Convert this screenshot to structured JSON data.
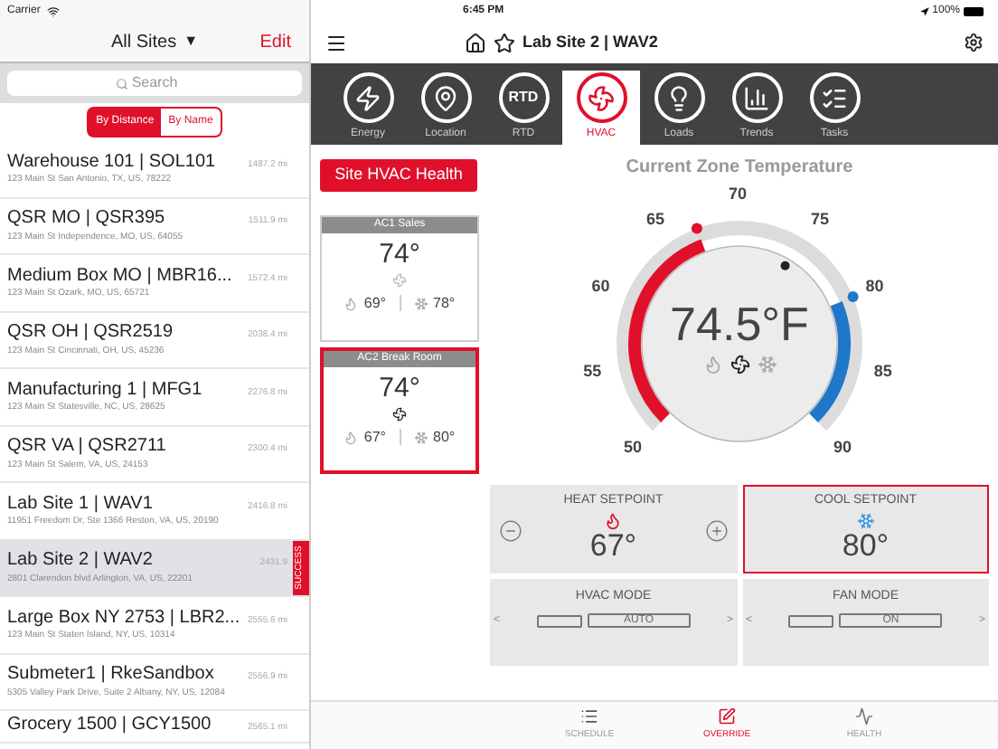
{
  "status_bar": {
    "carrier": "Carrier",
    "time": "6:45 PM",
    "battery": "100%"
  },
  "sidebar": {
    "title": "All Sites",
    "title_caret": "▼",
    "edit": "Edit",
    "search": {
      "placeholder": "Search"
    },
    "sort": [
      {
        "label": "By Distance",
        "selected": true
      },
      {
        "label": "By Name",
        "selected": false
      }
    ],
    "sites": [
      {
        "name": "Warehouse 101 | SOL101",
        "address": "123 Main St San Antonio, TX, US, 78222",
        "distance": "1487.2 mi",
        "selected": false
      },
      {
        "name": "QSR MO | QSR395",
        "address": "123 Main St Independence, MO, US, 64055",
        "distance": "1511.9 mi",
        "selected": false
      },
      {
        "name": "Medium Box MO | MBR16...",
        "address": "123 Main St Ozark, MO, US, 65721",
        "distance": "1572.4 mi",
        "selected": false
      },
      {
        "name": "QSR OH | QSR2519",
        "address": "123 Main St Cincinnati, OH, US, 45236",
        "distance": "2038.4 mi",
        "selected": false
      },
      {
        "name": "Manufacturing 1 | MFG1",
        "address": "123 Main St Statesville, NC, US, 28625",
        "distance": "2276.8 mi",
        "selected": false
      },
      {
        "name": "QSR VA | QSR2711",
        "address": "123 Main St Salem, VA, US, 24153",
        "distance": "2300.4 mi",
        "selected": false
      },
      {
        "name": "Lab Site 1 | WAV1",
        "address": "11951 Freedom Dr, Ste 1366 Reston, VA, US, 20190",
        "distance": "2416.8 mi",
        "selected": false
      },
      {
        "name": "Lab Site 2 | WAV2",
        "address": "2801 Clarendon blvd Arlington, VA, US, 22201",
        "distance": "2431.9",
        "selected": true,
        "badge": "SUCCESS"
      },
      {
        "name": "Large Box NY 2753 | LBR2...",
        "address": "123 Main St Staten Island, NY, US, 10314",
        "distance": "2555.6 mi",
        "selected": false
      },
      {
        "name": "Submeter1 | RkeSandbox",
        "address": "5305 Valley Park Drive, Suite 2 Albany, NY, US, 12084",
        "distance": "2556.9 mi",
        "selected": false
      },
      {
        "name": "Grocery 1500 | GCY1500",
        "distance": "2565.1 mi",
        "selected": false
      }
    ]
  },
  "header": {
    "title": "Lab Site 2 | WAV2"
  },
  "tabs": [
    {
      "kind": "energy",
      "label": "Energy",
      "selected": false
    },
    {
      "kind": "location",
      "label": "Location",
      "selected": false
    },
    {
      "kind": "rtd",
      "label": "RTD",
      "icon_text": "RTD",
      "selected": false
    },
    {
      "kind": "hvac",
      "label": "HVAC",
      "selected": true
    },
    {
      "kind": "loads",
      "label": "Loads",
      "selected": false
    },
    {
      "kind": "trends",
      "label": "Trends",
      "selected": false
    },
    {
      "kind": "tasks",
      "label": "Tasks",
      "selected": false
    }
  ],
  "health_button": "Site HVAC Health",
  "zones": [
    {
      "name": "AC1 Sales",
      "temp": "74°",
      "heat": "69°",
      "cool": "78°",
      "selected": false
    },
    {
      "name": "AC2 Break Room",
      "temp": "74°",
      "heat": "67°",
      "cool": "80°",
      "selected": true
    }
  ],
  "gauge": {
    "title": "Current Zone Temperature",
    "reading": "74.5°F",
    "scale": [
      "50",
      "55",
      "60",
      "65",
      "70",
      "75",
      "80",
      "85",
      "90"
    ]
  },
  "setpoints": [
    {
      "kind": "heat",
      "label": "HEAT SETPOINT",
      "value": "67°",
      "selected": false
    },
    {
      "kind": "cool",
      "label": "COOL SETPOINT",
      "value": "80°",
      "selected": true
    }
  ],
  "modes": [
    {
      "label": "HVAC MODE",
      "value": "AUTO",
      "prev": "<",
      "next": ">"
    },
    {
      "label": "FAN MODE",
      "value": "ON",
      "prev": "<",
      "next": ">"
    }
  ],
  "bottom_tabs": [
    {
      "kind": "schedule",
      "label": "SCHEDULE",
      "selected": false
    },
    {
      "kind": "override",
      "label": "OVERRIDE",
      "selected": true
    },
    {
      "kind": "health",
      "label": "HEALTH",
      "selected": false
    }
  ]
}
